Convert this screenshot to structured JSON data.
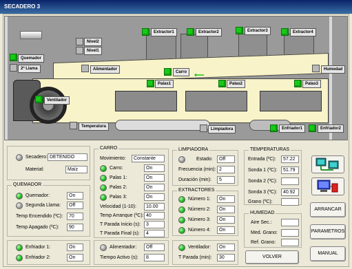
{
  "window": {
    "title": "SECADERO 3"
  },
  "diagram": {
    "extractors": [
      "Extractor1",
      "Extractor2",
      "Extractor3",
      "Extractor4"
    ],
    "nivel2": "Nivel2",
    "nivel1": "Nivel1",
    "quemador": "Quemador",
    "segunda_llama": "2ª Llama",
    "alimentador": "Alimentador",
    "carro": "Carro",
    "humedad": "Humedad",
    "ventilador": "Ventilador",
    "palas": [
      "Palas1",
      "Palas2",
      "Palas3"
    ],
    "temperatura": "Temperatura",
    "limpiadora": "Limpiadora",
    "enfriador1": "Enfriador1",
    "enfriador2": "Enfriador2"
  },
  "secadero": {
    "label": "Secadero:",
    "value": "DETENIDO",
    "material_label": "Material:",
    "material": "Maíz"
  },
  "quemador": {
    "title": "QUEMADOR",
    "quemador_label": "Quemador:",
    "quemador": "On",
    "llama_label": "Segunda Llama:",
    "llama": "Off",
    "t_enc_label": "Temp Encendido (ºC):",
    "t_enc": "70",
    "t_apag_label": "Temp Apagado (ºC):",
    "t_apag": "90"
  },
  "enfriadores": {
    "e1_label": "Enfriador 1:",
    "e1": "On",
    "e2_label": "Enfriador 2:",
    "e2": "On"
  },
  "carro": {
    "title": "CARRO",
    "mov_label": "Movimiento:",
    "mov": "Constante",
    "carro_label": "Carro:",
    "carro": "On",
    "p1_label": "Palas 1:",
    "p1": "On",
    "p2_label": "Palas 2:",
    "p2": "On",
    "p3_label": "Palas 3:",
    "p3": "On",
    "vel_label": "Velocidad (1-10):",
    "vel": "10.00",
    "tarr_label": "Temp Arranque (ºC):",
    "tarr": "40",
    "tpi_label": "T Parada Inicio (s):",
    "tpi": "3",
    "tpf_label": "T Parada Final (s):",
    "tpf": "4",
    "alim_label": "Alimentador:",
    "alim": "Off",
    "tact_label": "Tiempo Activo (s):",
    "tact": "8"
  },
  "limpiadora": {
    "title": "LIMPIADORA",
    "estado_label": "Estado:",
    "estado": "Off",
    "freq_label": "Frecuencia (min):",
    "freq": "2",
    "dur_label": "Duración (min):",
    "dur": "5"
  },
  "extractores": {
    "title": "EXTRACTORES",
    "n1_label": "Número 1:",
    "n1": "On",
    "n2_label": "Número 2:",
    "n2": "On",
    "n3_label": "Número 3:",
    "n3": "On",
    "n4_label": "Número 4:",
    "n4": "On",
    "vent_label": "Ventilador:",
    "vent": "On",
    "tpar_label": "T Parada (min):",
    "tpar": "30"
  },
  "temperaturas": {
    "title": "TEMPERATURAS",
    "entrada_label": "Entrada (ºC):",
    "entrada": "57.22",
    "s1_label": "Sonda 1 (ºC):",
    "s1": "51.79",
    "s2_label": "Sonda 2 (ºC):",
    "s2": "",
    "s3_label": "Sonda 3 (ºC):",
    "s3": "40.92",
    "grano_label": "Grano (ºC):",
    "grano": ""
  },
  "humedad": {
    "title": "HUMEDAD",
    "aire_label": "Aire Sec.:",
    "aire": "",
    "med_label": "Med. Grano:",
    "med": "",
    "ref_label": "Ref. Grano:",
    "ref": ""
  },
  "buttons": {
    "volver": "VOLVER",
    "arrancar": "ARRANCAR",
    "parametros": "PARAMETROS",
    "manual": "MANUAL"
  },
  "colors": {
    "led_on": "#17c917",
    "title_bar": "#0a246a",
    "conveyor": "#f8f3c8"
  },
  "icons": {
    "network": "network-icon",
    "computer": "computer-icon"
  }
}
